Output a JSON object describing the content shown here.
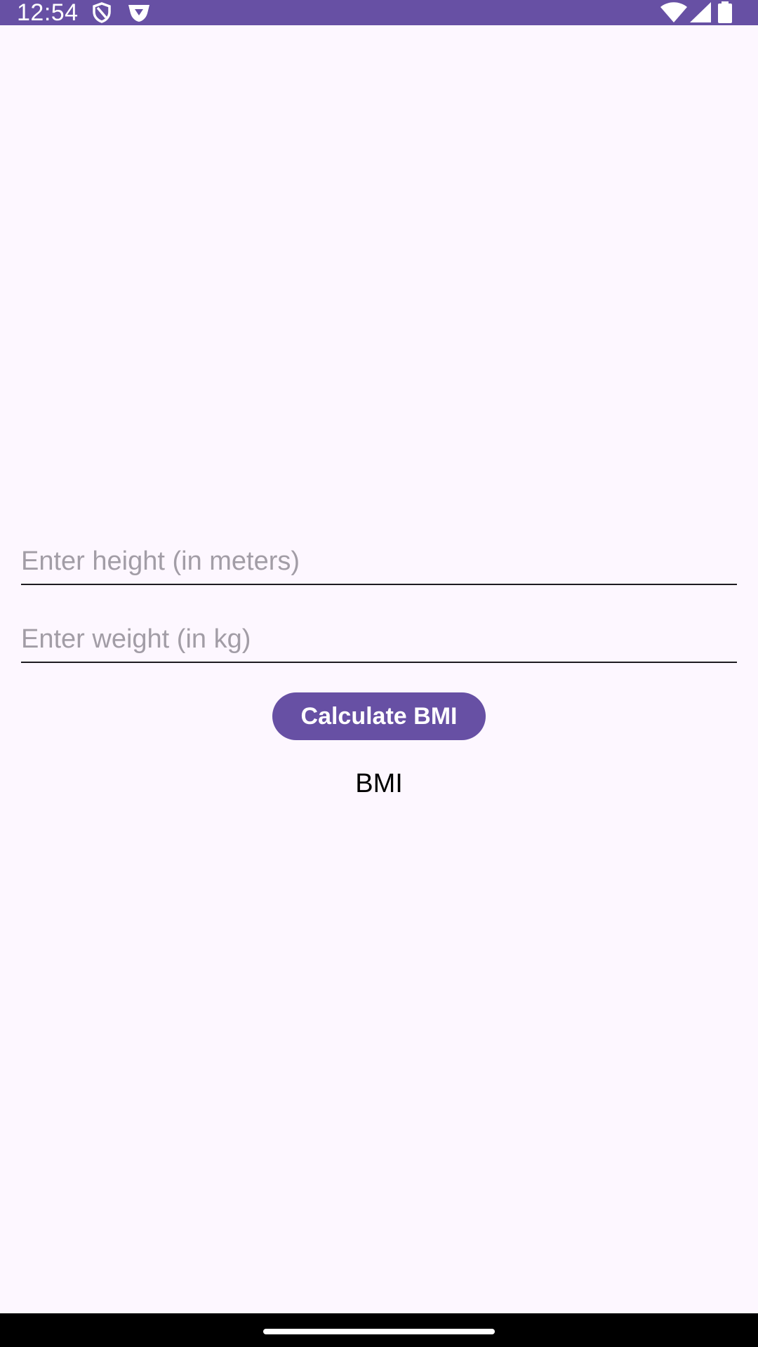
{
  "status_bar": {
    "time": "12:54",
    "background_color": "#6750A4",
    "left_icons": [
      "shield-icon",
      "download-badge-icon"
    ],
    "right_icons": [
      "wifi-icon",
      "cell-signal-icon",
      "battery-icon"
    ]
  },
  "form": {
    "height_placeholder": "Enter height (in meters)",
    "weight_placeholder": "Enter weight (in kg)",
    "height_value": "",
    "weight_value": "",
    "calculate_label": "Calculate BMI"
  },
  "result": {
    "text": "BMI"
  },
  "colors": {
    "accent": "#6750A4",
    "background": "#FDF7FF",
    "placeholder": "#A29DA6"
  },
  "nav_bar": {
    "handle_icon": "home-handle"
  }
}
